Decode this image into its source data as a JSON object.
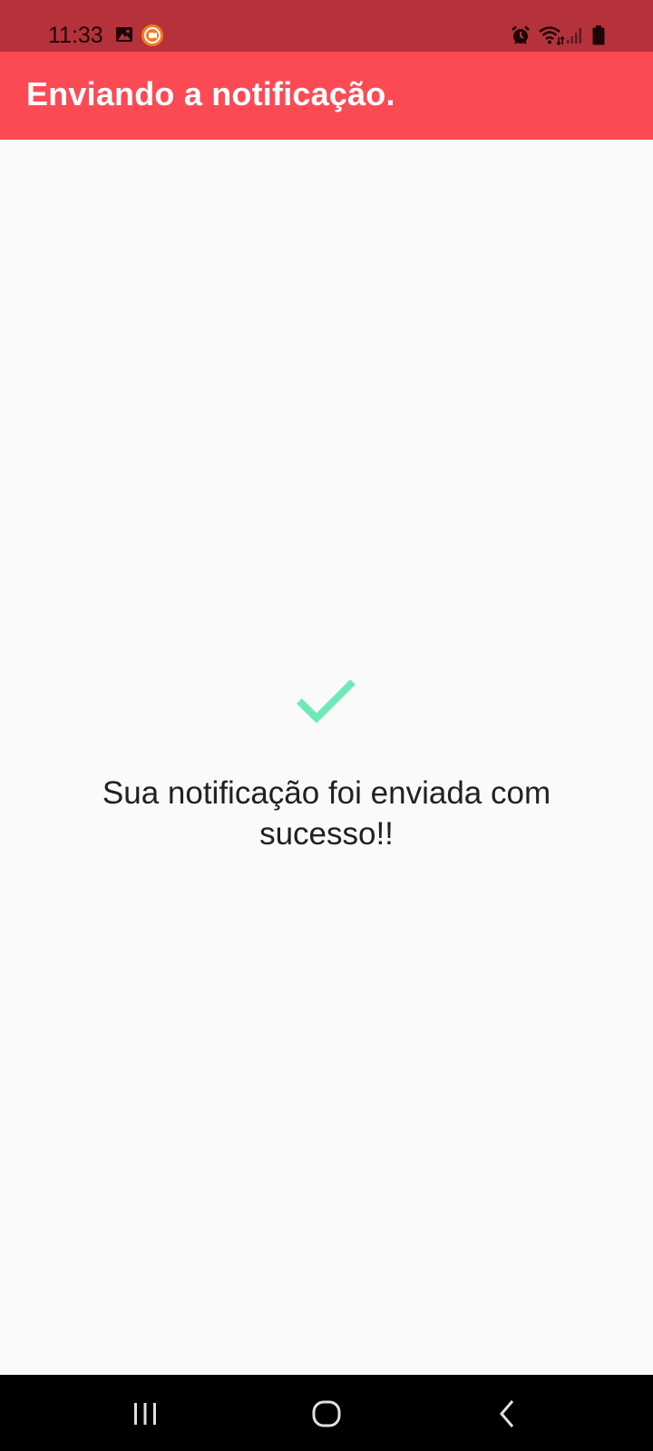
{
  "status_bar": {
    "time": "11:33",
    "background_color": "#b5323b",
    "icons": [
      "gallery-icon",
      "screen-recorder-icon",
      "alarm-icon",
      "wifi-icon",
      "signal-icon",
      "battery-icon"
    ]
  },
  "app_bar": {
    "title": "Enviando a notificação.",
    "background_color": "#fc4a55"
  },
  "main": {
    "icon": "check-icon",
    "icon_color": "#6eebb4",
    "message": "Sua notificação foi enviada com sucesso!!"
  },
  "nav_bar": {
    "buttons": [
      "recent-apps-icon",
      "home-icon",
      "back-icon"
    ]
  }
}
